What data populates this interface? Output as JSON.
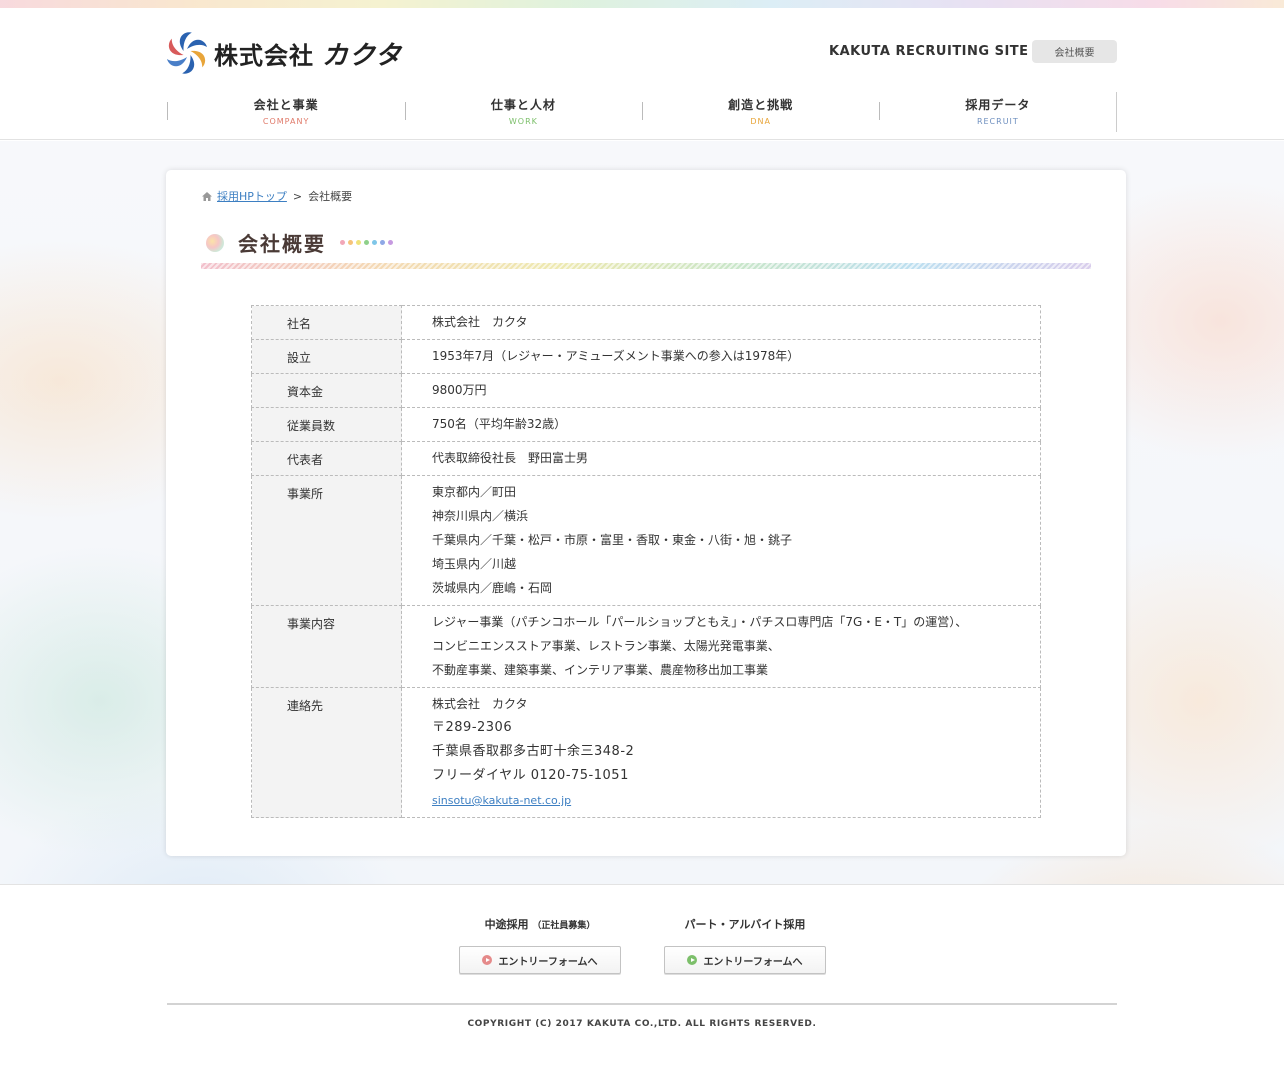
{
  "header": {
    "logo_text": "株式会社",
    "logo_text_katakana": "カクタ",
    "site_title": "KAKUTA RECRUITING SITE",
    "overview_button": "会社概要",
    "nav": [
      {
        "ja": "会社と事業",
        "en": "COMPANY",
        "color": "#e07a6a"
      },
      {
        "ja": "仕事と人材",
        "en": "WORK",
        "color": "#7cbf6a"
      },
      {
        "ja": "創造と挑戦",
        "en": "DNA",
        "color": "#e8a53a"
      },
      {
        "ja": "採用データ",
        "en": "RECRUIT",
        "color": "#6e8fbf"
      }
    ]
  },
  "breadcrumb": {
    "home_label": "採用HPトップ",
    "separator": ">",
    "current": "会社概要"
  },
  "page": {
    "heading": "会社概要",
    "heading_dot_colors": [
      "#f2a7b8",
      "#f6c37a",
      "#f0e27a",
      "#8fd08a",
      "#7fc6e8",
      "#8fa8e6",
      "#c69ae0"
    ]
  },
  "company_table": {
    "rows": [
      {
        "label": "社名",
        "lines": [
          "株式会社　カクタ"
        ]
      },
      {
        "label": "設立",
        "lines": [
          "1953年7月（レジャー・アミューズメント事業への参入は1978年）"
        ]
      },
      {
        "label": "資本金",
        "lines": [
          "9800万円"
        ]
      },
      {
        "label": "従業員数",
        "lines": [
          "750名（平均年齢32歳）"
        ]
      },
      {
        "label": "代表者",
        "lines": [
          "代表取締役社長　野田富士男"
        ]
      },
      {
        "label": "事業所",
        "lines": [
          "東京都内／町田",
          "神奈川県内／横浜",
          "千葉県内／千葉・松戸・市原・富里・香取・東金・八街・旭・銚子",
          "埼玉県内／川越",
          "茨城県内／鹿嶋・石岡"
        ]
      },
      {
        "label": "事業内容",
        "lines": [
          "レジャー事業（パチンコホール「パールショップともえ」・パチスロ専門店「7G・E・T」の運営）、",
          "コンビニエンスストア事業、レストラン事業、太陽光発電事業、",
          "不動産事業、建築事業、インテリア事業、農産物移出加工事業"
        ]
      },
      {
        "label": "連絡先",
        "lines": [
          "株式会社　カクタ",
          "〒289-2306",
          "千葉県香取郡多古町十余三348-2",
          "フリーダイヤル 0120-75-1051"
        ],
        "email": "sinsotu@kakuta-net.co.jp"
      }
    ]
  },
  "footer": {
    "midcareer_title": "中途採用",
    "midcareer_sub": "（正社員募集）",
    "parttime_title": "パート・アルバイト採用",
    "entry_button": "エントリーフォームへ",
    "midcareer_icon_color": "#e58a8a",
    "parttime_icon_color": "#7cbf6a",
    "copyright": "COPYRIGHT (C) 2017 KAKUTA CO.,LTD. ALL RIGHTS RESERVED."
  }
}
